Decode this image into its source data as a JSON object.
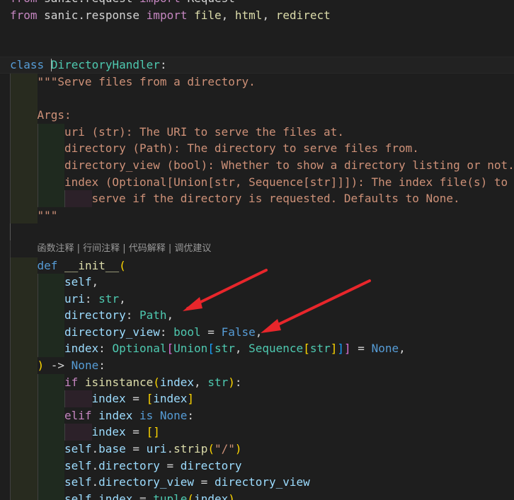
{
  "editor": {
    "lines": [
      {
        "indent": [],
        "tokens": [
          [
            "kw2",
            "from"
          ],
          [
            "txt",
            " "
          ],
          [
            "txt",
            "sanic.request"
          ],
          [
            "txt",
            " "
          ],
          [
            "kw2",
            "import"
          ],
          [
            "txt",
            " Request"
          ]
        ]
      },
      {
        "indent": [],
        "tokens": [
          [
            "kw2",
            "from"
          ],
          [
            "txt",
            " "
          ],
          [
            "txt",
            "sanic.response"
          ],
          [
            "txt",
            " "
          ],
          [
            "kw2",
            "import"
          ],
          [
            "txt",
            " "
          ],
          [
            "fn",
            "file"
          ],
          [
            "txt",
            ", "
          ],
          [
            "fn",
            "html"
          ],
          [
            "txt",
            ", "
          ],
          [
            "fn",
            "redirect"
          ]
        ]
      },
      {
        "indent": [],
        "tokens": []
      },
      {
        "indent": [],
        "tokens": []
      },
      {
        "indent": [],
        "cursor": true,
        "tokens": [
          [
            "kw",
            "class"
          ],
          [
            "txt",
            " "
          ],
          [
            "caret",
            ""
          ],
          [
            "cls",
            "DirectoryHandler"
          ],
          [
            "txt",
            ":"
          ]
        ]
      },
      {
        "indent": [
          "g1"
        ],
        "tokens": [
          [
            "str",
            "\"\"\"Serve files from a directory."
          ]
        ]
      },
      {
        "indent": [
          "g1"
        ],
        "tokens": []
      },
      {
        "indent": [
          "g1"
        ],
        "tokens": [
          [
            "str",
            "Args:"
          ]
        ]
      },
      {
        "indent": [
          "g1",
          "g2"
        ],
        "tokens": [
          [
            "str",
            "uri (str): The URI to serve the files at."
          ]
        ]
      },
      {
        "indent": [
          "g1",
          "g2"
        ],
        "tokens": [
          [
            "str",
            "directory (Path): The directory to serve files from."
          ]
        ]
      },
      {
        "indent": [
          "g1",
          "g2"
        ],
        "tokens": [
          [
            "str",
            "directory_view (bool): Whether to show a directory listing or not."
          ]
        ]
      },
      {
        "indent": [
          "g1",
          "g2"
        ],
        "tokens": [
          [
            "str",
            "index (Optional[Union[str, Sequence[str]]]): The index file(s) to"
          ]
        ]
      },
      {
        "indent": [
          "g1",
          "g2",
          "g3"
        ],
        "tokens": [
          [
            "str",
            "serve if the directory is requested. Defaults to None."
          ]
        ]
      },
      {
        "indent": [
          "g1"
        ],
        "tokens": [
          [
            "str",
            "\"\"\""
          ]
        ]
      },
      {
        "indent": [
          "bar"
        ],
        "tokens": []
      },
      {
        "indent": [
          "plain"
        ],
        "codelens": true,
        "tokens": [
          [
            "codelens",
            "函数注释 | 行间注释 | 代码解释 | 调优建议"
          ]
        ]
      },
      {
        "indent": [
          "g1"
        ],
        "tokens": [
          [
            "kw",
            "def"
          ],
          [
            "txt",
            " "
          ],
          [
            "fn",
            "__init__"
          ],
          [
            "br1",
            "("
          ]
        ]
      },
      {
        "indent": [
          "g1",
          "g2"
        ],
        "tokens": [
          [
            "var",
            "self"
          ],
          [
            "txt",
            ","
          ]
        ]
      },
      {
        "indent": [
          "g1",
          "g2"
        ],
        "tokens": [
          [
            "var",
            "uri"
          ],
          [
            "txt",
            ": "
          ],
          [
            "cls",
            "str"
          ],
          [
            "txt",
            ","
          ]
        ]
      },
      {
        "indent": [
          "g1",
          "g2"
        ],
        "tokens": [
          [
            "var",
            "directory"
          ],
          [
            "txt",
            ": "
          ],
          [
            "cls",
            "Path"
          ],
          [
            "txt",
            ","
          ]
        ]
      },
      {
        "indent": [
          "g1",
          "g2"
        ],
        "tokens": [
          [
            "var",
            "directory_view"
          ],
          [
            "txt",
            ": "
          ],
          [
            "cls",
            "bool"
          ],
          [
            "txt",
            " = "
          ],
          [
            "kw",
            "False"
          ],
          [
            "txt",
            ","
          ]
        ]
      },
      {
        "indent": [
          "g1",
          "g2"
        ],
        "tokens": [
          [
            "var",
            "index"
          ],
          [
            "txt",
            ": "
          ],
          [
            "cls",
            "Optional"
          ],
          [
            "br2",
            "["
          ],
          [
            "cls",
            "Union"
          ],
          [
            "br3",
            "["
          ],
          [
            "cls",
            "str"
          ],
          [
            "txt",
            ", "
          ],
          [
            "cls",
            "Sequence"
          ],
          [
            "br1",
            "["
          ],
          [
            "cls",
            "str"
          ],
          [
            "br1",
            "]"
          ],
          [
            "br3",
            "]"
          ],
          [
            "br2",
            "]"
          ],
          [
            "txt",
            " = "
          ],
          [
            "kw",
            "None"
          ],
          [
            "txt",
            ","
          ]
        ]
      },
      {
        "indent": [
          "g1"
        ],
        "tokens": [
          [
            "br1",
            ")"
          ],
          [
            "txt",
            " -> "
          ],
          [
            "kw",
            "None"
          ],
          [
            "txt",
            ":"
          ]
        ]
      },
      {
        "indent": [
          "g1",
          "g2"
        ],
        "tokens": [
          [
            "kw2",
            "if"
          ],
          [
            "txt",
            " "
          ],
          [
            "fn",
            "isinstance"
          ],
          [
            "br1",
            "("
          ],
          [
            "var",
            "index"
          ],
          [
            "txt",
            ", "
          ],
          [
            "cls",
            "str"
          ],
          [
            "br1",
            ")"
          ],
          [
            "txt",
            ":"
          ]
        ]
      },
      {
        "indent": [
          "g1",
          "g2",
          "g3"
        ],
        "tokens": [
          [
            "var",
            "index"
          ],
          [
            "txt",
            " = "
          ],
          [
            "br1",
            "["
          ],
          [
            "var",
            "index"
          ],
          [
            "br1",
            "]"
          ]
        ]
      },
      {
        "indent": [
          "g1",
          "g2"
        ],
        "tokens": [
          [
            "kw2",
            "elif"
          ],
          [
            "txt",
            " "
          ],
          [
            "var",
            "index"
          ],
          [
            "txt",
            " "
          ],
          [
            "kw",
            "is"
          ],
          [
            "txt",
            " "
          ],
          [
            "kw",
            "None"
          ],
          [
            "txt",
            ":"
          ]
        ]
      },
      {
        "indent": [
          "g1",
          "g2",
          "g3"
        ],
        "tokens": [
          [
            "var",
            "index"
          ],
          [
            "txt",
            " = "
          ],
          [
            "br1",
            "[]"
          ]
        ]
      },
      {
        "indent": [
          "g1",
          "g2"
        ],
        "tokens": [
          [
            "var",
            "self"
          ],
          [
            "txt",
            "."
          ],
          [
            "var",
            "base"
          ],
          [
            "txt",
            " = "
          ],
          [
            "var",
            "uri"
          ],
          [
            "txt",
            "."
          ],
          [
            "fn",
            "strip"
          ],
          [
            "br1",
            "("
          ],
          [
            "str",
            "\"/\""
          ],
          [
            "br1",
            ")"
          ]
        ]
      },
      {
        "indent": [
          "g1",
          "g2"
        ],
        "tokens": [
          [
            "var",
            "self"
          ],
          [
            "txt",
            "."
          ],
          [
            "var",
            "directory"
          ],
          [
            "txt",
            " = "
          ],
          [
            "var",
            "directory"
          ]
        ]
      },
      {
        "indent": [
          "g1",
          "g2"
        ],
        "tokens": [
          [
            "var",
            "self"
          ],
          [
            "txt",
            "."
          ],
          [
            "var",
            "directory_view"
          ],
          [
            "txt",
            " = "
          ],
          [
            "var",
            "directory_view"
          ]
        ]
      },
      {
        "indent": [
          "g1",
          "g2"
        ],
        "tokens": [
          [
            "var",
            "self"
          ],
          [
            "txt",
            "."
          ],
          [
            "var",
            "index"
          ],
          [
            "txt",
            " = "
          ],
          [
            "cls",
            "tuple"
          ],
          [
            "br1",
            "("
          ],
          [
            "var",
            "index"
          ],
          [
            "br1",
            ")"
          ]
        ]
      }
    ]
  },
  "annotation": {
    "arrow_color": "#e8262b"
  }
}
